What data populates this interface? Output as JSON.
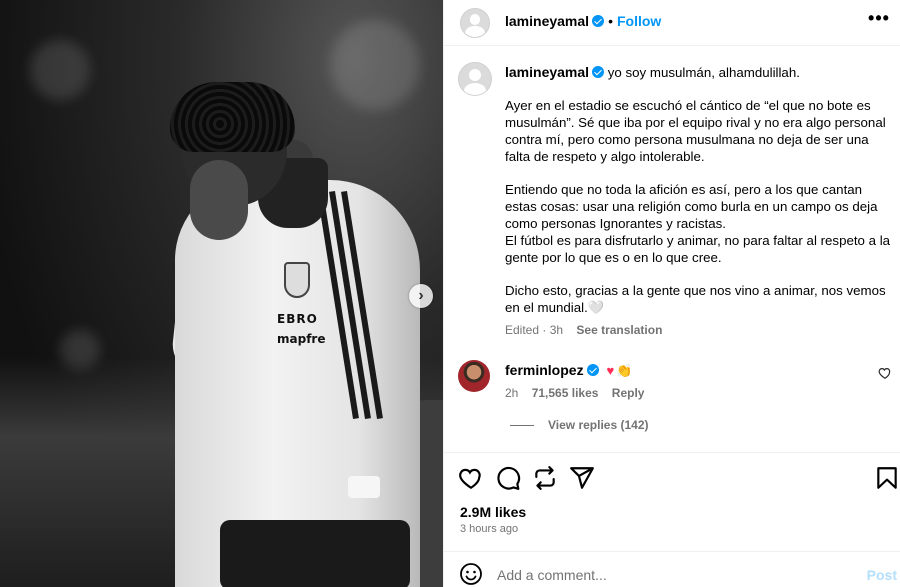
{
  "post": {
    "username": "lamineyamal",
    "follow_label": "Follow",
    "more_label": "•••",
    "caption": {
      "first_line": "yo soy musulmán, alhamdulillah.",
      "p1": "Ayer en el estadio se escuchó el cántico de “el que no bote es musulmán”. Sé que iba por el equipo rival y no era algo personal contra mí, pero como persona musulmana no deja de ser una falta de respeto y algo intolerable.",
      "p2a": "Entiendo que no toda la afición es así, pero a los que cantan estas cosas: usar una religión como burla en un campo os deja como personas Ignorantes y racistas.",
      "p2b": "El fútbol es para disfrutarlo y animar, no para faltar al respeto a la gente por lo que es o en lo que cree.",
      "p3": "Dicho esto, gracias a la gente que nos vino a animar, nos vemos en el mundial.",
      "p3_emoji": "🤍"
    },
    "edited": "Edited · 3h",
    "see_translation": "See translation",
    "likes": "2.9M likes",
    "time_ago": "3 hours ago"
  },
  "comment": {
    "username": "ferminlopez",
    "emoji_heart": "♥",
    "emoji_clap": "👏",
    "age": "2h",
    "likes": "71,565 likes",
    "reply": "Reply",
    "view_replies": "View replies (142)"
  },
  "composer": {
    "placeholder": "Add a comment...",
    "post_label": "Post"
  },
  "photo": {
    "sponsor_1": "EBRO",
    "sponsor_2": "mapfre",
    "carousel_next": "›"
  },
  "colors": {
    "accent": "#0095f6",
    "muted": "#737373",
    "post_disabled": "#b2dffc",
    "like_red": "#ff2c55"
  },
  "icons": [
    "heart-icon",
    "comment-icon",
    "share-icon",
    "send-icon",
    "bookmark-icon",
    "emoji-icon",
    "more-icon",
    "verified-icon",
    "carousel-next-icon"
  ]
}
